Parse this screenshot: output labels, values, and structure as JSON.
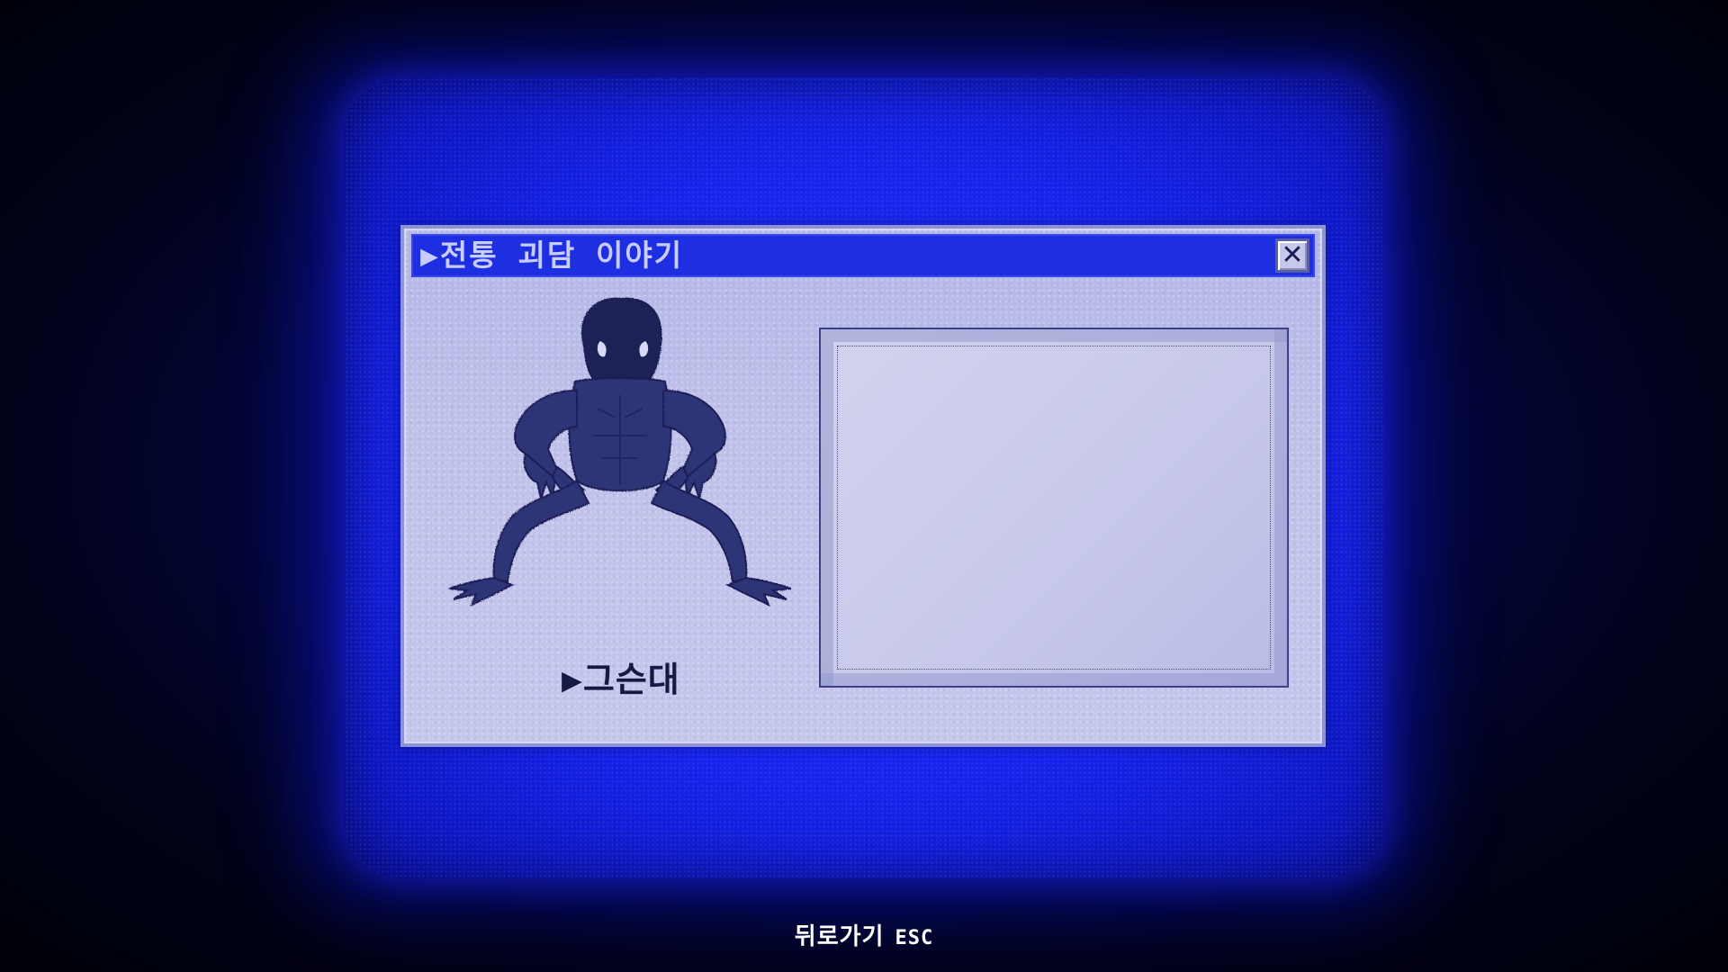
{
  "window": {
    "title": "▶전통 괴담 이야기",
    "close_symbol": "✕"
  },
  "creature": {
    "name": "▶그슨대",
    "image_icon": "crouching-shadow-creature"
  },
  "description": {
    "text": ""
  },
  "footer": {
    "back_label": "뒤로가기",
    "back_key": "ESC"
  },
  "colors": {
    "crt_blue": "#1624ee",
    "titlebar": "#1d2fe0",
    "window_bg": "#bfc1ea",
    "creature_ink": "#2a3070"
  }
}
